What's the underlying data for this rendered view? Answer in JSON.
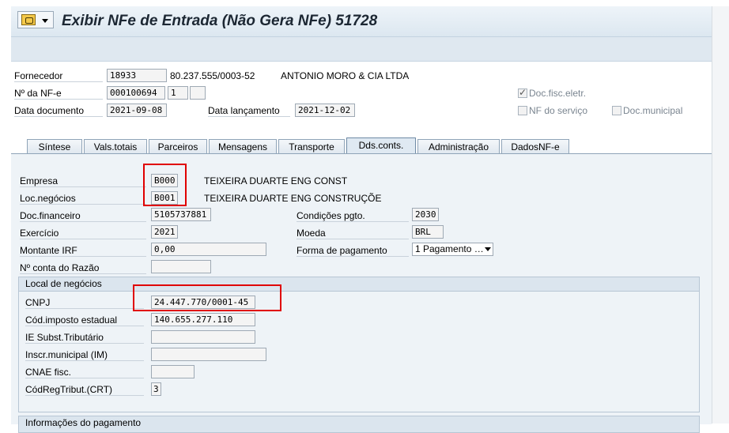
{
  "window": {
    "title": "Exibir NFe de Entrada (Não Gera NFe) 51728"
  },
  "header": {
    "fornecedor_label": "Fornecedor",
    "fornecedor_code": "18933",
    "fornecedor_cnpj": "80.237.555/0003-52",
    "fornecedor_name": "ANTONIO MORO & CIA LTDA",
    "nfe_label": "Nº da NF-e",
    "nfe_number": "000100694",
    "nfe_series": "1",
    "nfe_sub": "",
    "data_doc_label": "Data documento",
    "data_doc_value": "2021-09-08",
    "data_lanc_label": "Data lançamento",
    "data_lanc_value": "2021-12-02",
    "doc_fisc_eletr_label": "Doc.fisc.eletr.",
    "doc_fisc_eletr_checked": true,
    "nf_servico_label": "NF do serviço",
    "nf_servico_checked": false,
    "doc_municipal_label": "Doc.municipal",
    "doc_municipal_checked": false
  },
  "tabs": [
    {
      "label": "Síntese",
      "active": false
    },
    {
      "label": "Vals.totais",
      "active": false
    },
    {
      "label": "Parceiros",
      "active": false
    },
    {
      "label": "Mensagens",
      "active": false
    },
    {
      "label": "Transporte",
      "active": false
    },
    {
      "label": "Dds.conts.",
      "active": true
    },
    {
      "label": "Administração",
      "active": false
    },
    {
      "label": "DadosNF-e",
      "active": false
    }
  ],
  "content": {
    "empresa_label": "Empresa",
    "empresa_value": "B000",
    "empresa_name": "TEIXEIRA DUARTE ENG CONST",
    "locneg_label": "Loc.negócios",
    "locneg_value": "B001",
    "locneg_name": "TEIXEIRA DUARTE ENG CONSTRUÇÕE",
    "docfin_label": "Doc.financeiro",
    "docfin_value": "5105737881",
    "exercicio_label": "Exercício",
    "exercicio_value": "2021",
    "montante_label": "Montante IRF",
    "montante_value": "0,00",
    "conta_razao_label": "Nº conta do Razão",
    "conta_razao_value": "",
    "cond_pgto_label": "Condições pgto.",
    "cond_pgto_value": "2030",
    "moeda_label": "Moeda",
    "moeda_value": "BRL",
    "forma_pgto_label": "Forma de pagamento",
    "forma_pgto_value": "1 Pagamento …"
  },
  "local_negocios": {
    "title": "Local de negócios",
    "cnpj_label": "CNPJ",
    "cnpj_value": "24.447.770/0001-45",
    "imp_estadual_label": "Cód.imposto estadual",
    "imp_estadual_value": "140.655.277.110",
    "ie_subst_label": "IE Subst.Tributário",
    "ie_subst_value": "",
    "inscr_municipal_label": "Inscr.municipal (IM)",
    "inscr_municipal_value": "",
    "cnae_label": "CNAE fisc.",
    "cnae_value": "",
    "crt_label": "CódRegTribut.(CRT)",
    "crt_value": "3"
  },
  "informacoes_pagamento": {
    "title": "Informações do pagamento"
  },
  "colors": {
    "highlight": "#e00000",
    "panel": "#eef3f7"
  }
}
